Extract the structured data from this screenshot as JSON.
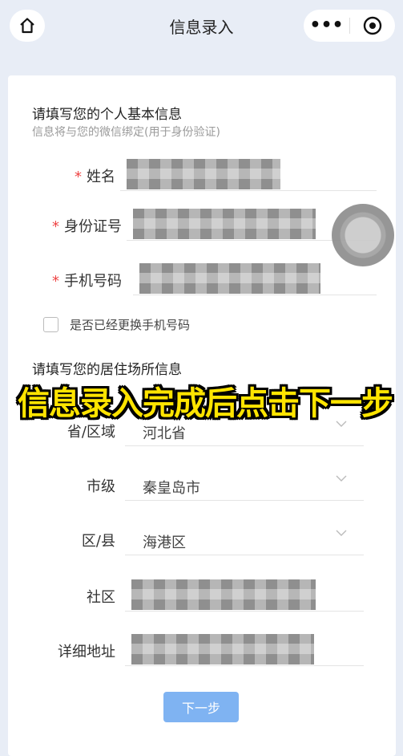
{
  "header": {
    "title": "信息录入",
    "more_glyph": "•••",
    "icons": {
      "home": "home-icon",
      "more": "more-icon",
      "target": "target-icon"
    }
  },
  "form": {
    "basic": {
      "title": "请填写您的个人基本信息",
      "subtitle": "信息将与您的微信绑定(用于身份验证)",
      "fields": [
        {
          "label": "姓名",
          "required": true
        },
        {
          "label": "身份证号",
          "required": true
        },
        {
          "label": "手机号码",
          "required": true
        }
      ],
      "checkbox_label": "是否已经更换手机号码"
    },
    "residence": {
      "title": "请填写您的居住场所信息",
      "fields": [
        {
          "label": "省/区域",
          "value": "河北省"
        },
        {
          "label": "市级",
          "value": "秦皇岛市"
        },
        {
          "label": "区/县",
          "value": "海港区"
        },
        {
          "label": "社区"
        },
        {
          "label": "详细地址"
        }
      ]
    },
    "required_mark": "*",
    "next_button": "下一步"
  },
  "overlay": {
    "caption": "信息录入完成后点击下一步"
  },
  "colors": {
    "background": "#e8edf6",
    "accent_button": "#7fb3f2",
    "required": "#e44444",
    "caption": "#ffe400"
  }
}
